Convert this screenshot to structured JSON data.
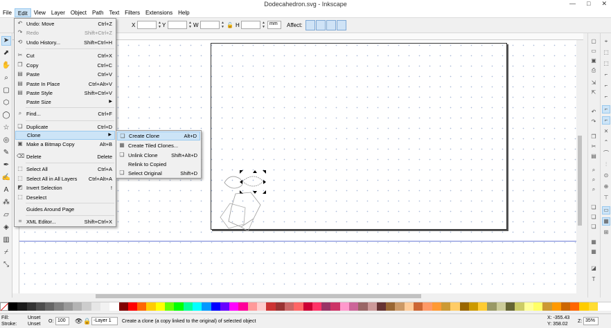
{
  "window": {
    "title": "Dodecahedron.svg - Inkscape",
    "minimize": "—",
    "maximize": "□",
    "close": "✕"
  },
  "menubar": [
    "File",
    "Edit",
    "View",
    "Layer",
    "Object",
    "Path",
    "Text",
    "Filters",
    "Extensions",
    "Help"
  ],
  "controls": {
    "x_label": "X",
    "y_label": "Y",
    "w_label": "W",
    "h_label": "H",
    "x_value": "",
    "y_value": "",
    "w_value": "",
    "h_value": "",
    "unit": "mm",
    "affect_label": "Affect:"
  },
  "edit_menu": [
    {
      "label": "Undo: Move",
      "shortcut": "Ctrl+Z",
      "icon": "undo-icon",
      "glyph": "↶",
      "disabled": false
    },
    {
      "label": "Redo",
      "shortcut": "Shift+Ctrl+Z",
      "icon": "redo-icon",
      "glyph": "↷",
      "disabled": true
    },
    {
      "label": "Undo History...",
      "shortcut": "Shift+Ctrl+H",
      "icon": "history-icon",
      "glyph": "⟲",
      "disabled": false
    },
    {
      "label": "Cut",
      "shortcut": "Ctrl+X",
      "icon": "cut-icon",
      "glyph": "✂",
      "disabled": false
    },
    {
      "label": "Copy",
      "shortcut": "Ctrl+C",
      "icon": "copy-icon",
      "glyph": "❐",
      "disabled": false
    },
    {
      "label": "Paste",
      "shortcut": "Ctrl+V",
      "icon": "paste-icon",
      "glyph": "▤",
      "disabled": false
    },
    {
      "label": "Paste In Place",
      "shortcut": "Ctrl+Alt+V",
      "icon": "paste-in-place-icon",
      "glyph": "▤",
      "disabled": false
    },
    {
      "label": "Paste Style",
      "shortcut": "Shift+Ctrl+V",
      "icon": "paste-style-icon",
      "glyph": "▤",
      "disabled": false
    },
    {
      "label": "Paste Size",
      "shortcut": "",
      "icon": "",
      "glyph": "",
      "disabled": false,
      "submenu": true
    },
    {
      "label": "Find...",
      "shortcut": "Ctrl+F",
      "icon": "find-icon",
      "glyph": "⌕",
      "disabled": false
    },
    {
      "label": "Duplicate",
      "shortcut": "Ctrl+D",
      "icon": "duplicate-icon",
      "glyph": "❏",
      "disabled": false
    },
    {
      "label": "Clone",
      "shortcut": "",
      "icon": "",
      "glyph": "",
      "disabled": false,
      "submenu": true,
      "highlighted": true
    },
    {
      "label": "Make a Bitmap Copy",
      "shortcut": "Alt+B",
      "icon": "bitmap-copy-icon",
      "glyph": "▣",
      "disabled": false
    },
    {
      "label": "Delete",
      "shortcut": "Delete",
      "icon": "delete-icon",
      "glyph": "⌫",
      "disabled": false
    },
    {
      "label": "Select All",
      "shortcut": "Ctrl+A",
      "icon": "select-all-icon",
      "glyph": "⬚",
      "disabled": false
    },
    {
      "label": "Select All in All Layers",
      "shortcut": "Ctrl+Alt+A",
      "icon": "select-all-layers-icon",
      "glyph": "⬚",
      "disabled": false
    },
    {
      "label": "Invert Selection",
      "shortcut": "!",
      "icon": "invert-selection-icon",
      "glyph": "◩",
      "disabled": false
    },
    {
      "label": "Deselect",
      "shortcut": "",
      "icon": "deselect-icon",
      "glyph": "⬚",
      "disabled": false
    },
    {
      "label": "Guides Around Page",
      "shortcut": "",
      "icon": "",
      "glyph": "",
      "disabled": false
    },
    {
      "label": "XML Editor...",
      "shortcut": "Shift+Ctrl+X",
      "icon": "xml-editor-icon",
      "glyph": "⌗",
      "disabled": false
    }
  ],
  "clone_submenu": [
    {
      "label": "Create Clone",
      "shortcut": "Alt+D",
      "icon": "create-clone-icon",
      "glyph": "❏",
      "highlighted": true
    },
    {
      "label": "Create Tiled Clones...",
      "shortcut": "",
      "icon": "tiled-clones-icon",
      "glyph": "▦"
    },
    {
      "label": "Unlink Clone",
      "shortcut": "Shift+Alt+D",
      "icon": "unlink-clone-icon",
      "glyph": "❏"
    },
    {
      "label": "Relink to Copied",
      "shortcut": "",
      "icon": "",
      "glyph": ""
    },
    {
      "label": "Select Original",
      "shortcut": "Shift+D",
      "icon": "select-original-icon",
      "glyph": "❏"
    }
  ],
  "status": {
    "fill_label": "Fill:",
    "fill_value": "Unset",
    "stroke_label": "Stroke:",
    "stroke_value": "Unset",
    "opacity_label": "O:",
    "opacity_value": "100",
    "layer": "-Layer 1",
    "message": "Create a clone (a copy linked to the original) of selected object",
    "x_coord": "X: -355.43",
    "y_coord": "Y: 358.02",
    "zoom_label": "Z:",
    "zoom": "35%"
  },
  "palette_colors": [
    "#000000",
    "#1a1a1a",
    "#333333",
    "#4d4d4d",
    "#666666",
    "#808080",
    "#999999",
    "#b3b3b3",
    "#cccccc",
    "#e6e6e6",
    "#f2f2f2",
    "#ffffff",
    "#800000",
    "#ff0000",
    "#ff6600",
    "#ffcc00",
    "#ffff00",
    "#66ff00",
    "#00ff00",
    "#00ff99",
    "#00ffff",
    "#0099ff",
    "#0000ff",
    "#6600ff",
    "#ff00ff",
    "#ff0099",
    "#ff9999",
    "#ffcccc",
    "#cc3333",
    "#993333",
    "#cc6666",
    "#ff6666",
    "#cc0033",
    "#ff3366",
    "#993366",
    "#cc3366",
    "#ff99cc",
    "#cc6699",
    "#996666",
    "#cc9999",
    "#663333",
    "#996633",
    "#cc9966",
    "#ffcc99",
    "#cc6633",
    "#ff9966",
    "#ff9933",
    "#cc9933",
    "#ffcc66",
    "#996600",
    "#cc9900",
    "#ffcc33",
    "#999966",
    "#cccc99",
    "#666633",
    "#cccc66",
    "#ffff99",
    "#ffff66",
    "#cc9933",
    "#ff9900",
    "#cc6600",
    "#ff6600",
    "#ffcc00",
    "#ffdd33"
  ]
}
